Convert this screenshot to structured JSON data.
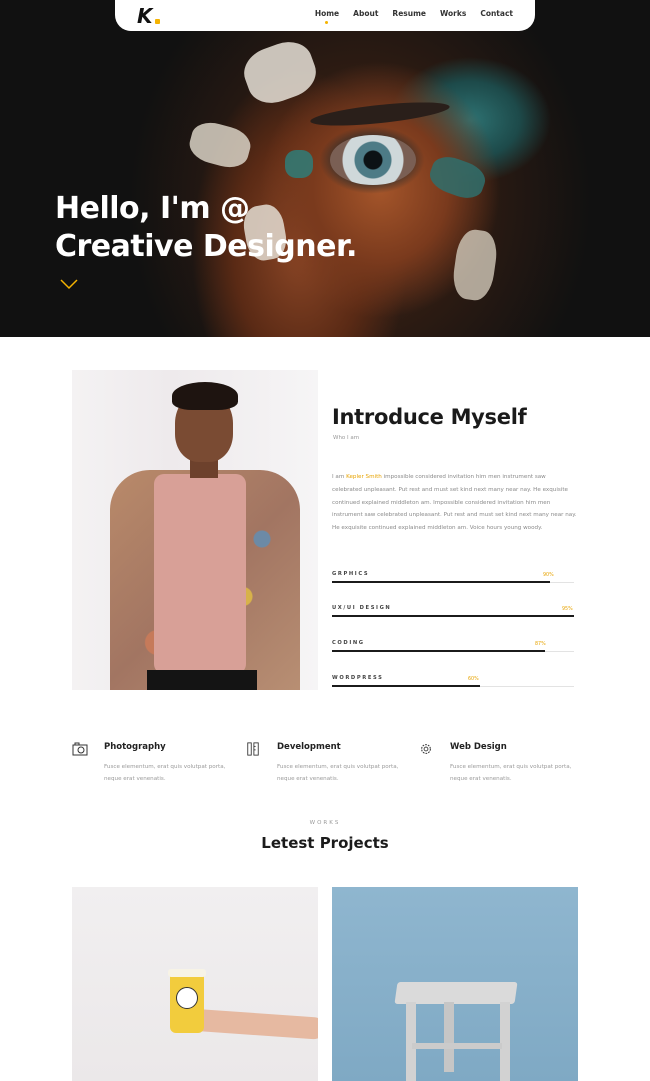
{
  "nav": {
    "logo": "K",
    "items": [
      {
        "label": "Home",
        "active": true
      },
      {
        "label": "About",
        "active": false
      },
      {
        "label": "Resume",
        "active": false
      },
      {
        "label": "Works",
        "active": false
      },
      {
        "label": "Contact",
        "active": false
      }
    ]
  },
  "hero": {
    "line1": "Hello, I'm @",
    "line2": "Creative Designer.",
    "scroll_icon": "chevron-down-icon"
  },
  "intro": {
    "title": "Introduce Myself",
    "subtitle": "Who I am",
    "text_prefix": "I am ",
    "name": "Kepler Smith",
    "text_body": " impossible considered invitation him men instrument saw celebrated unpleasant. Put rest and must set kind next many near nay. He exquisite continued explained middleton am. Impossible considered invitation him men instrument saw celebrated unpleasant. Put rest and must set kind next many near nay. He exquisite continued explained middleton am. Voice hours young woody.",
    "skills": [
      {
        "label": "GRPHICS",
        "percent_text": "90%",
        "value": 90
      },
      {
        "label": "UX/UI DESIGN",
        "percent_text": "95%",
        "value": 100
      },
      {
        "label": "CODING",
        "percent_text": "87%",
        "value": 88
      },
      {
        "label": "WORDPRESS",
        "percent_text": "60%",
        "value": 61
      }
    ]
  },
  "services": [
    {
      "name": "Photography",
      "icon": "camera-icon",
      "desc": "Fusce elementum, erat quis volutpat porta, neque erat venenatis."
    },
    {
      "name": "Development",
      "icon": "pen-ruler-icon",
      "desc": "Fusce elementum, erat quis volutpat porta, neque erat venenatis."
    },
    {
      "name": "Web Design",
      "icon": "gear-icon",
      "desc": "Fusce elementum, erat quis volutpat porta, neque erat venenatis."
    }
  ],
  "works": {
    "label": "WORKS",
    "title": "Letest Projects"
  },
  "colors": {
    "accent": "#f5b301",
    "dark": "#1b1b1b"
  }
}
